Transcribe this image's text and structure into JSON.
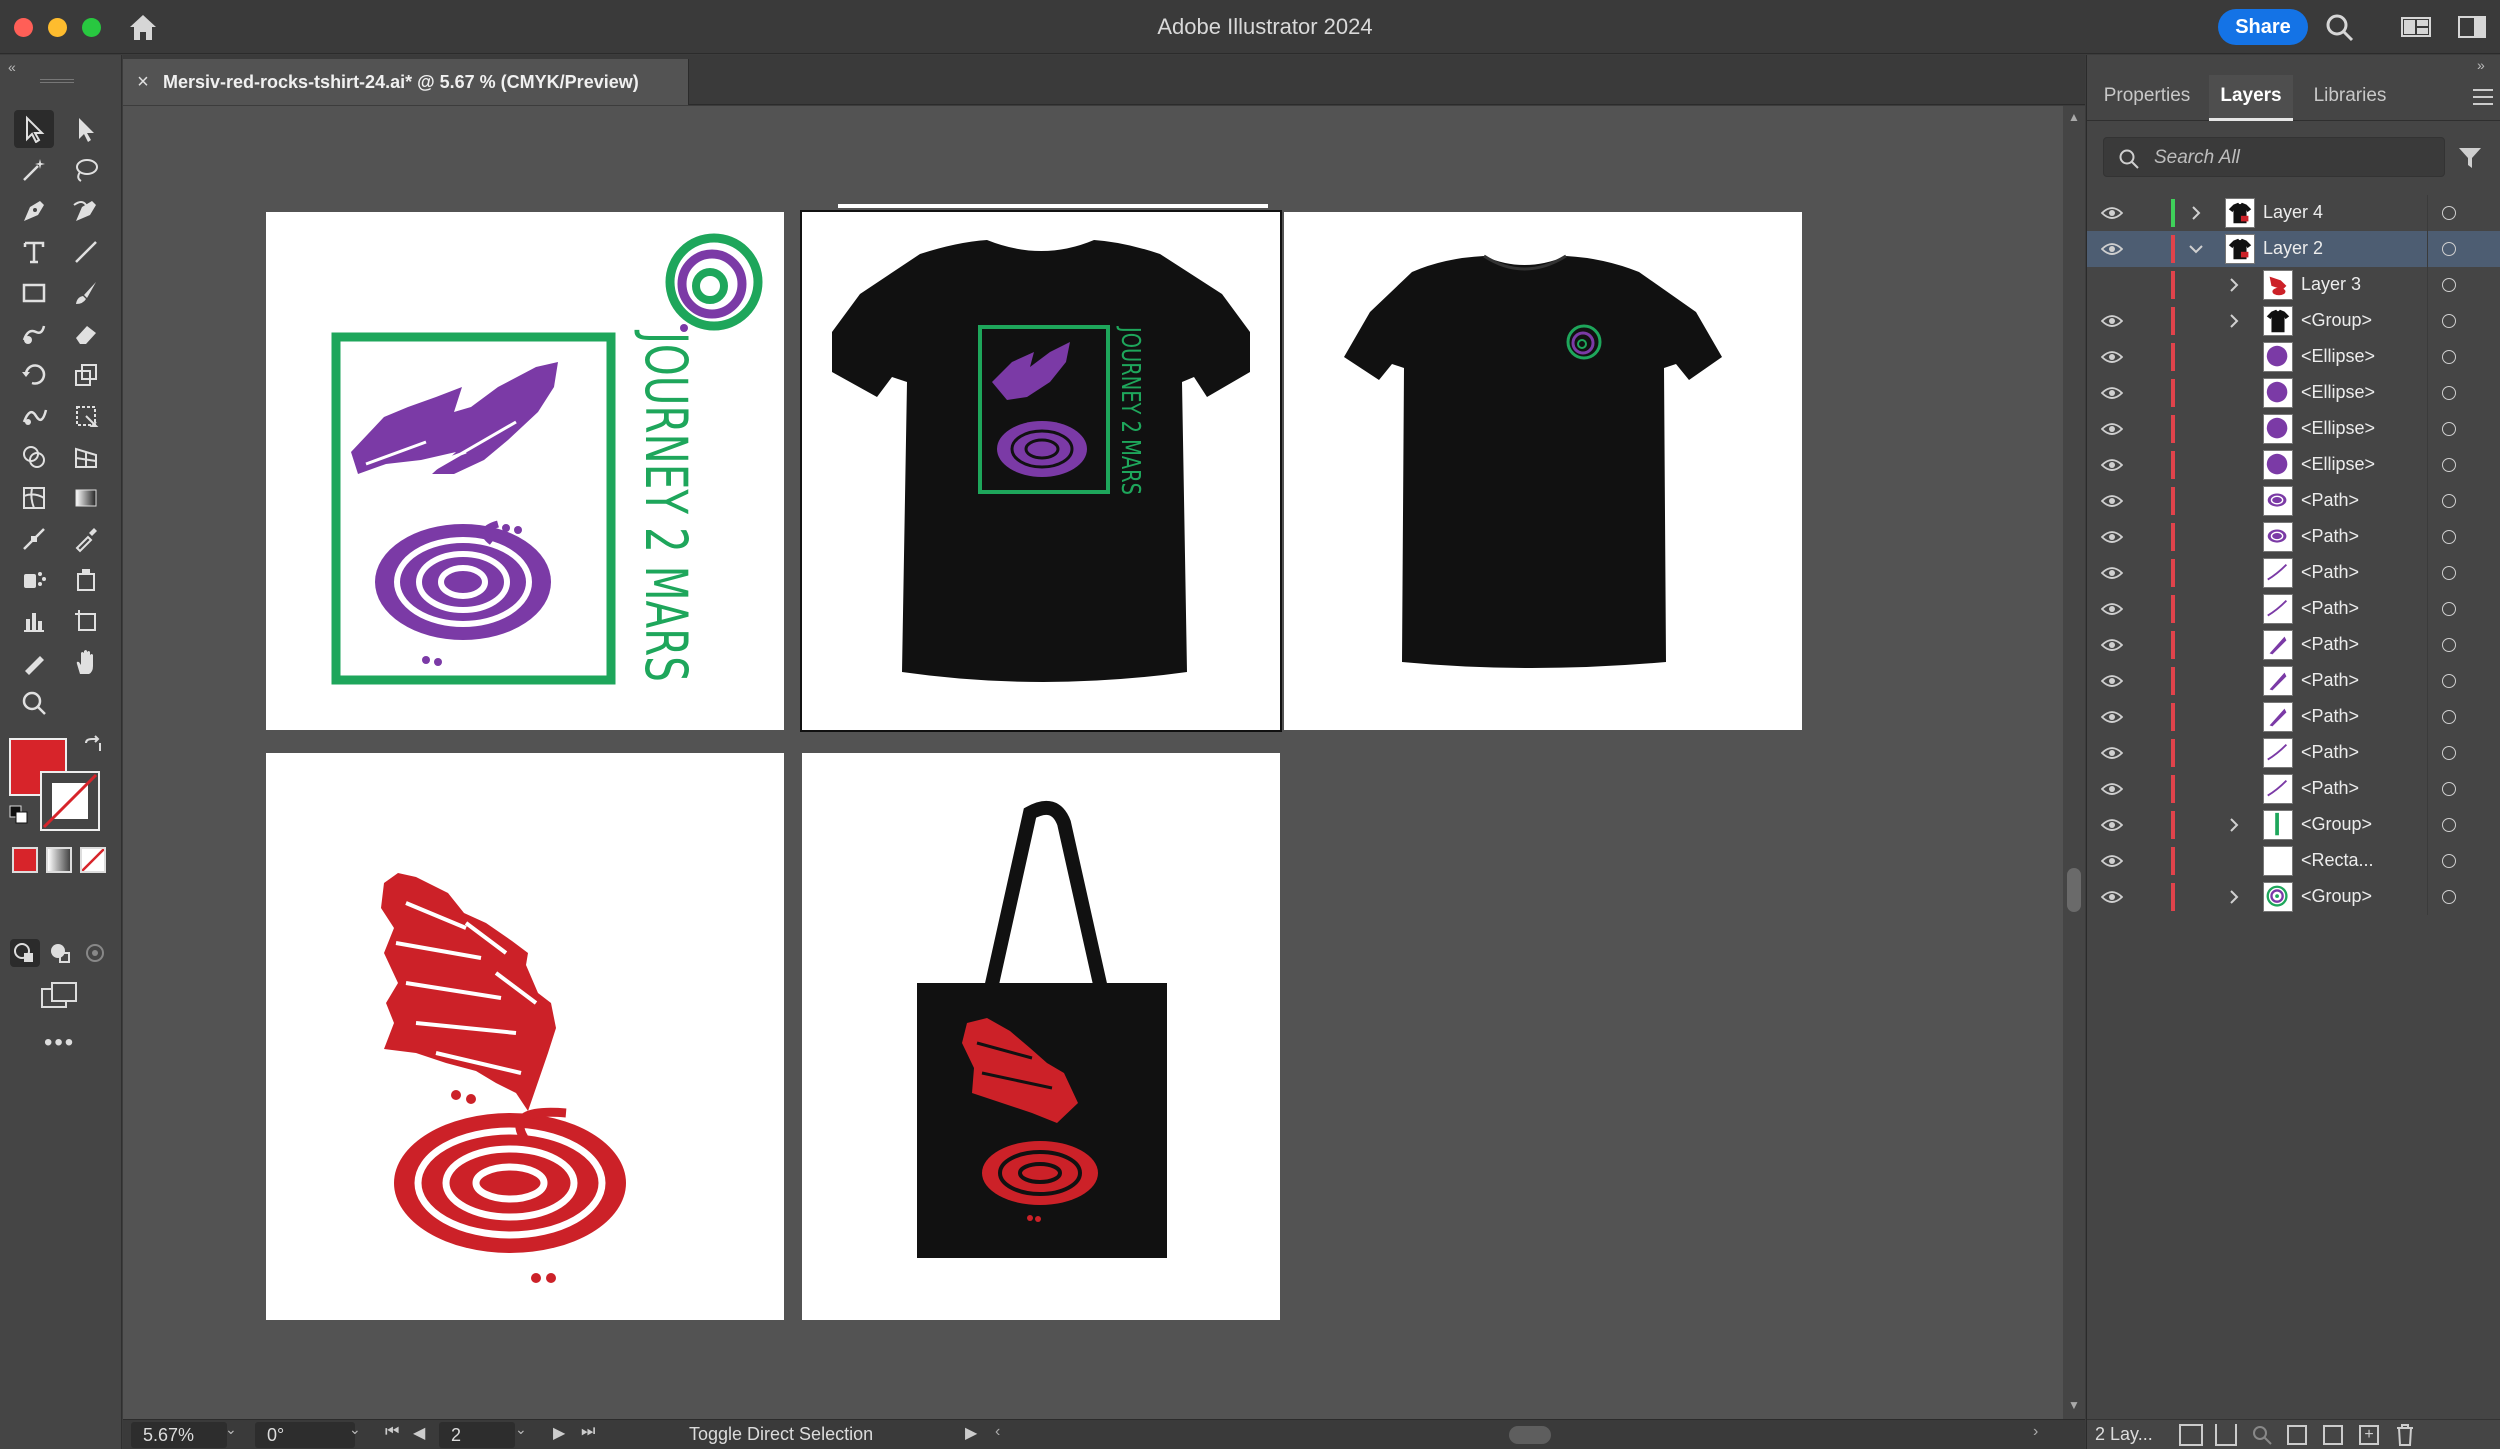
{
  "app": {
    "title": "Adobe Illustrator 2024",
    "share_label": "Share"
  },
  "document": {
    "tab_title": "Mersiv-red-rocks-tshirt-24.ai* @ 5.67 % (CMYK/Preview)"
  },
  "artwork": {
    "logo_text": "JOURNEY 2 MARS"
  },
  "colors": {
    "fill": "#d7242a",
    "accent": "#1473e6",
    "green": "#1ea65b",
    "purple": "#7b3aa6",
    "red": "#cc2128"
  },
  "status": {
    "zoom": "5.67%",
    "rotation": "0°",
    "artboard": "2",
    "tool_hint": "Toggle Direct Selection"
  },
  "panel": {
    "tabs": [
      "Properties",
      "Layers",
      "Libraries"
    ],
    "active_tab": "Layers",
    "search_placeholder": "Search All",
    "footer_label": "2 Lay...",
    "layers": [
      {
        "name": "Layer 4",
        "level": 0,
        "expand": "right",
        "color": "#3fd15a",
        "thumb": "shirt",
        "visible": true
      },
      {
        "name": "Layer 2",
        "level": 0,
        "expand": "down",
        "color": "#e0434b",
        "thumb": "shirt",
        "visible": true,
        "selected": true
      },
      {
        "name": "Layer 3",
        "level": 1,
        "expand": "right",
        "color": "#e0434b",
        "thumb": "red",
        "visible": false
      },
      {
        "name": "<Group>",
        "level": 1,
        "expand": "right",
        "color": "#e0434b",
        "thumb": "tee",
        "visible": true
      },
      {
        "name": "<Ellipse>",
        "level": 1,
        "expand": "",
        "color": "#e0434b",
        "thumb": "purple",
        "visible": true
      },
      {
        "name": "<Ellipse>",
        "level": 1,
        "expand": "",
        "color": "#e0434b",
        "thumb": "purple",
        "visible": true
      },
      {
        "name": "<Ellipse>",
        "level": 1,
        "expand": "",
        "color": "#e0434b",
        "thumb": "purple",
        "visible": true
      },
      {
        "name": "<Ellipse>",
        "level": 1,
        "expand": "",
        "color": "#e0434b",
        "thumb": "purple",
        "visible": true
      },
      {
        "name": "<Path>",
        "level": 1,
        "expand": "",
        "color": "#e0434b",
        "thumb": "swirl",
        "visible": true
      },
      {
        "name": "<Path>",
        "level": 1,
        "expand": "",
        "color": "#e0434b",
        "thumb": "swirl",
        "visible": true
      },
      {
        "name": "<Path>",
        "level": 1,
        "expand": "",
        "color": "#e0434b",
        "thumb": "line",
        "visible": true
      },
      {
        "name": "<Path>",
        "level": 1,
        "expand": "",
        "color": "#e0434b",
        "thumb": "line",
        "visible": true
      },
      {
        "name": "<Path>",
        "level": 1,
        "expand": "",
        "color": "#e0434b",
        "thumb": "stroke",
        "visible": true
      },
      {
        "name": "<Path>",
        "level": 1,
        "expand": "",
        "color": "#e0434b",
        "thumb": "stroke",
        "visible": true
      },
      {
        "name": "<Path>",
        "level": 1,
        "expand": "",
        "color": "#e0434b",
        "thumb": "stroke",
        "visible": true
      },
      {
        "name": "<Path>",
        "level": 1,
        "expand": "",
        "color": "#e0434b",
        "thumb": "line",
        "visible": true
      },
      {
        "name": "<Path>",
        "level": 1,
        "expand": "",
        "color": "#e0434b",
        "thumb": "line",
        "visible": true
      },
      {
        "name": "<Group>",
        "level": 1,
        "expand": "right",
        "color": "#e0434b",
        "thumb": "green",
        "visible": true
      },
      {
        "name": "<Recta...",
        "level": 1,
        "expand": "",
        "color": "#e0434b",
        "thumb": "blank",
        "visible": true
      },
      {
        "name": "<Group>",
        "level": 1,
        "expand": "right",
        "color": "#e0434b",
        "thumb": "spiral",
        "visible": true
      }
    ]
  }
}
